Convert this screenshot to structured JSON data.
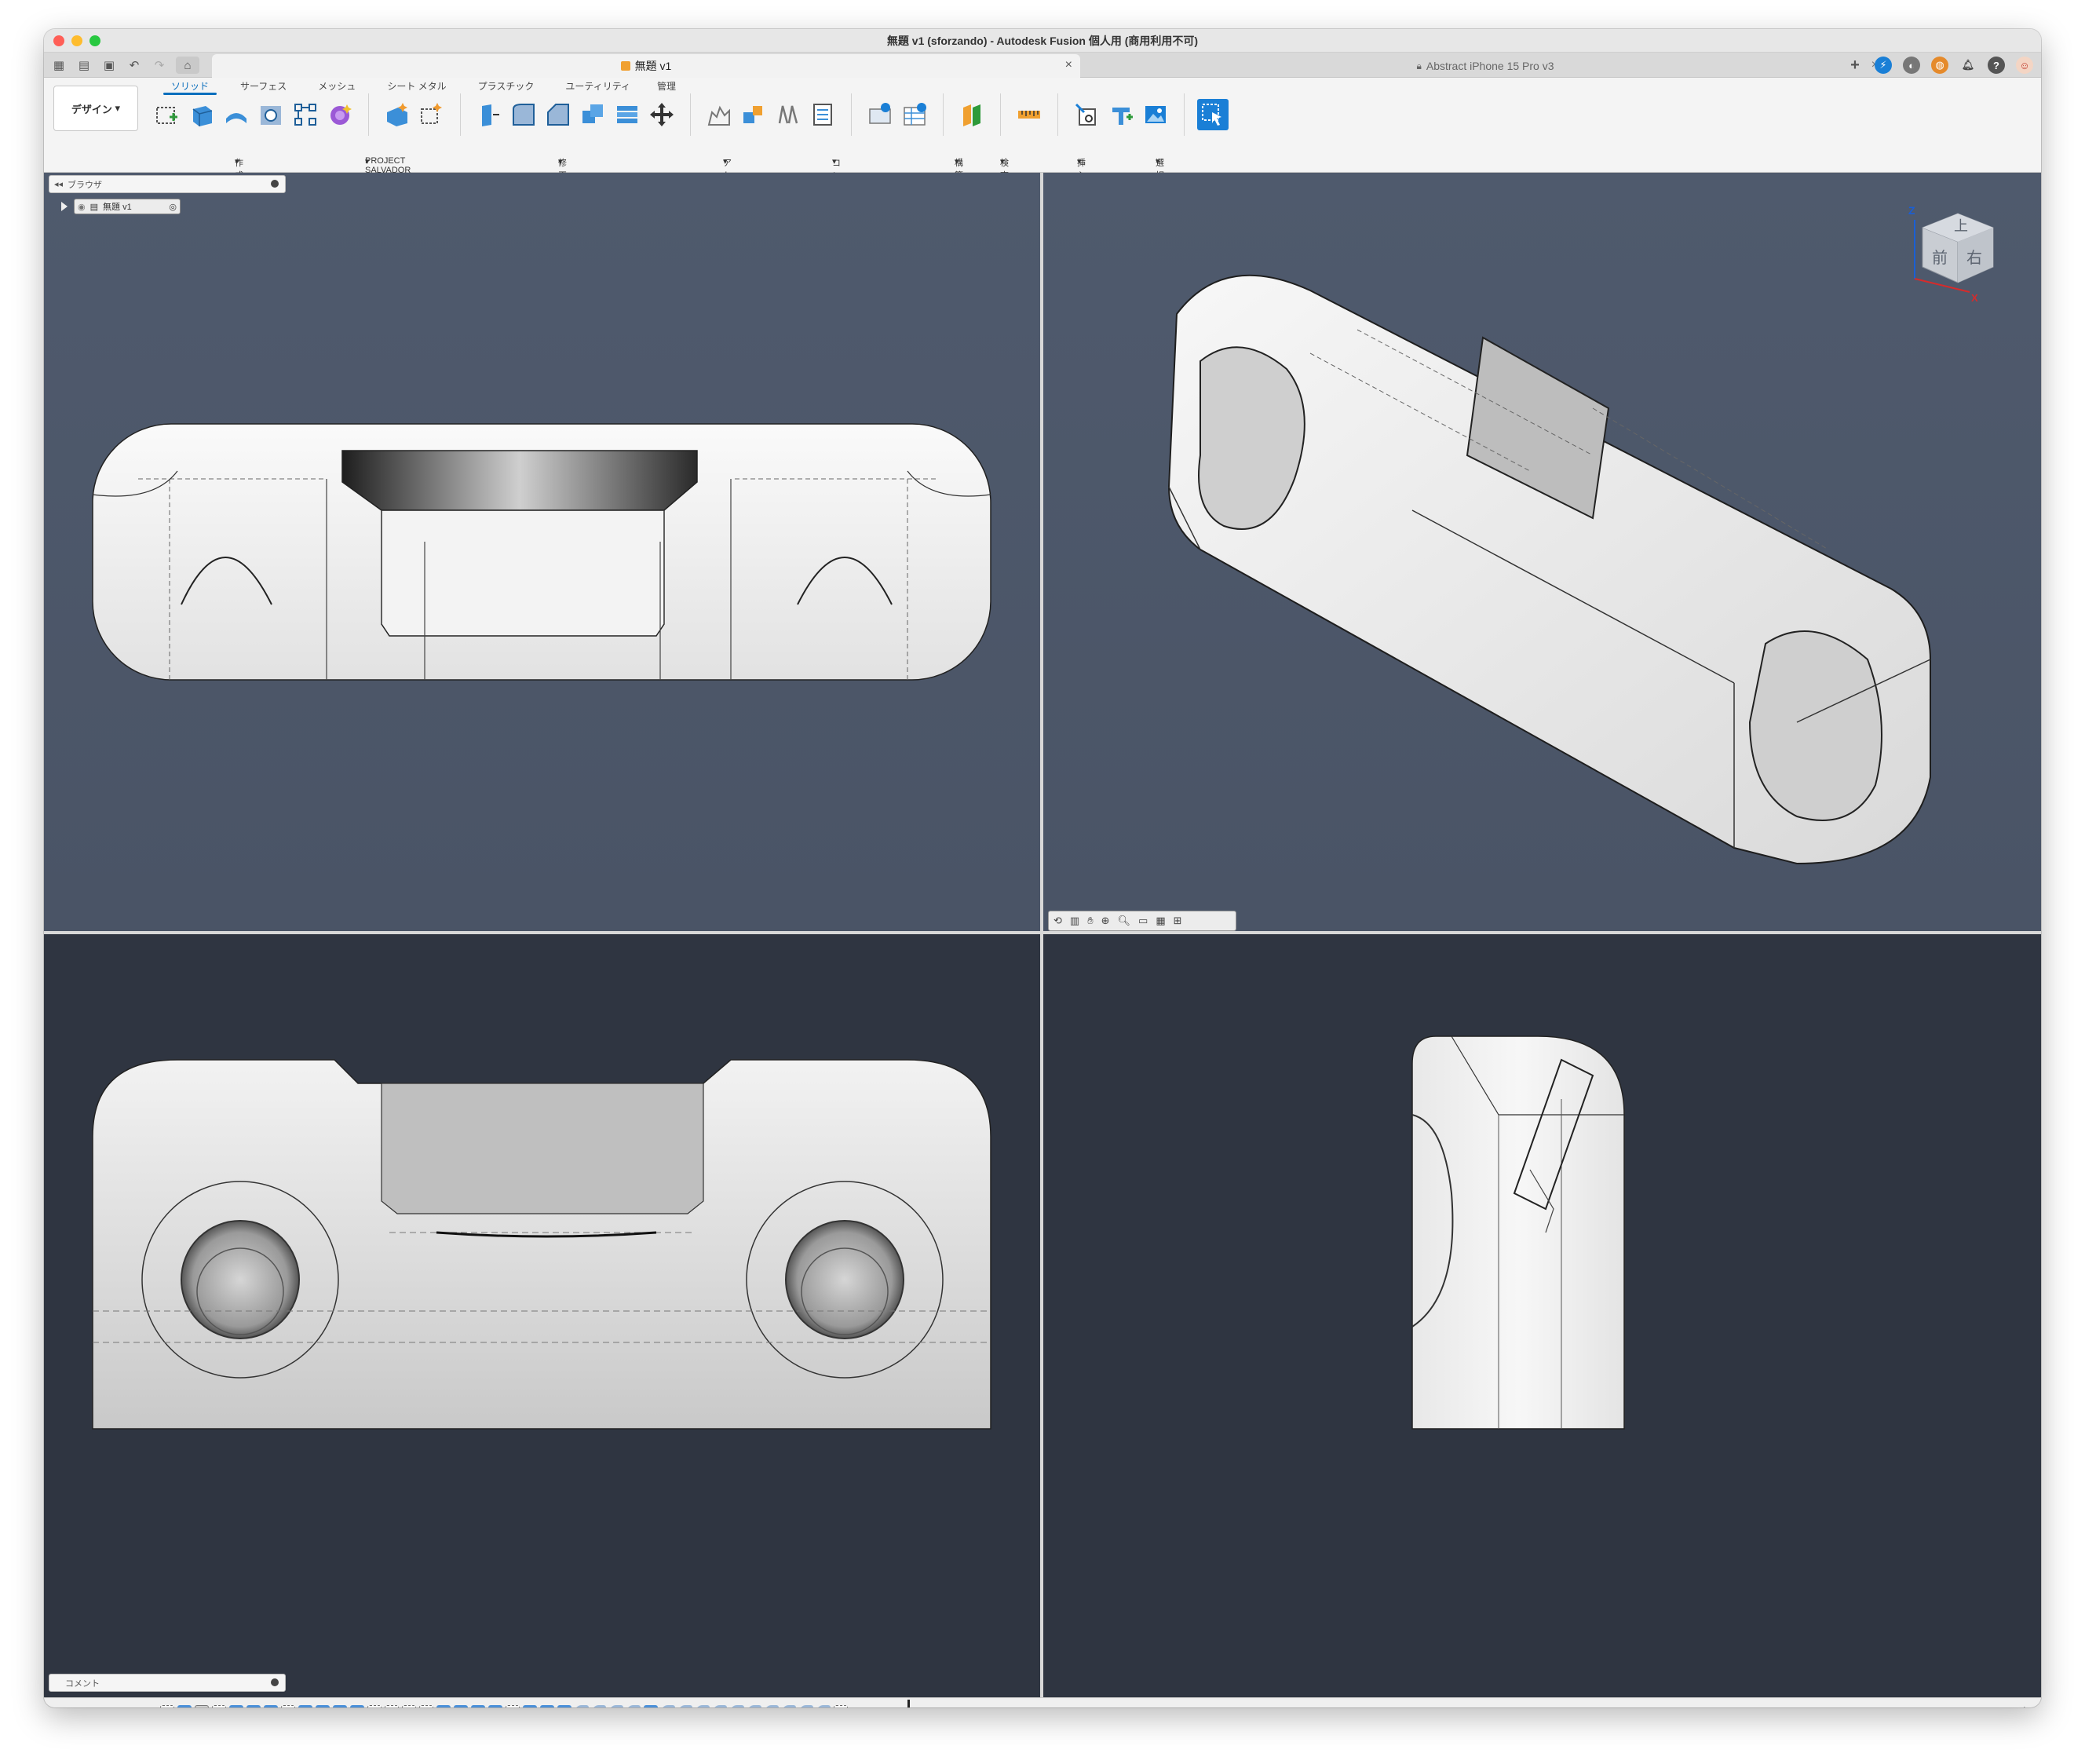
{
  "window": {
    "title": "無題 v1 (sforzando) - Autodesk Fusion 個人用 (商用利用不可)"
  },
  "tabs": [
    {
      "label": "無題 v1",
      "icon": "cube-icon"
    },
    {
      "label": "Abstract iPhone 15 Pro v3",
      "icon": "lock-icon"
    }
  ],
  "ribbon": {
    "workspace": "デザイン",
    "tabs": [
      "ソリッド",
      "サーフェス",
      "メッシュ",
      "シート メタル",
      "プラスチック",
      "ユーティリティ",
      "管理"
    ],
    "groups": [
      "作成",
      "PROJECT SALVADOR",
      "修正",
      "アセンブリ",
      "コンフィギュレーション",
      "構築",
      "検査",
      "挿入",
      "選択"
    ]
  },
  "browser": {
    "title": "ブラウザ",
    "root_item": "無題 v1"
  },
  "comments": {
    "title": "コメント"
  },
  "viewcube": {
    "top": "上",
    "front": "前",
    "right": "右",
    "axis_z": "Z",
    "axis_x": "X"
  },
  "colors": {
    "viewport_top_left": "#4b5567",
    "viewport_top_right": "#4b5567",
    "viewport_bottom": "#2e3440",
    "accent": "#0a6ebd"
  }
}
